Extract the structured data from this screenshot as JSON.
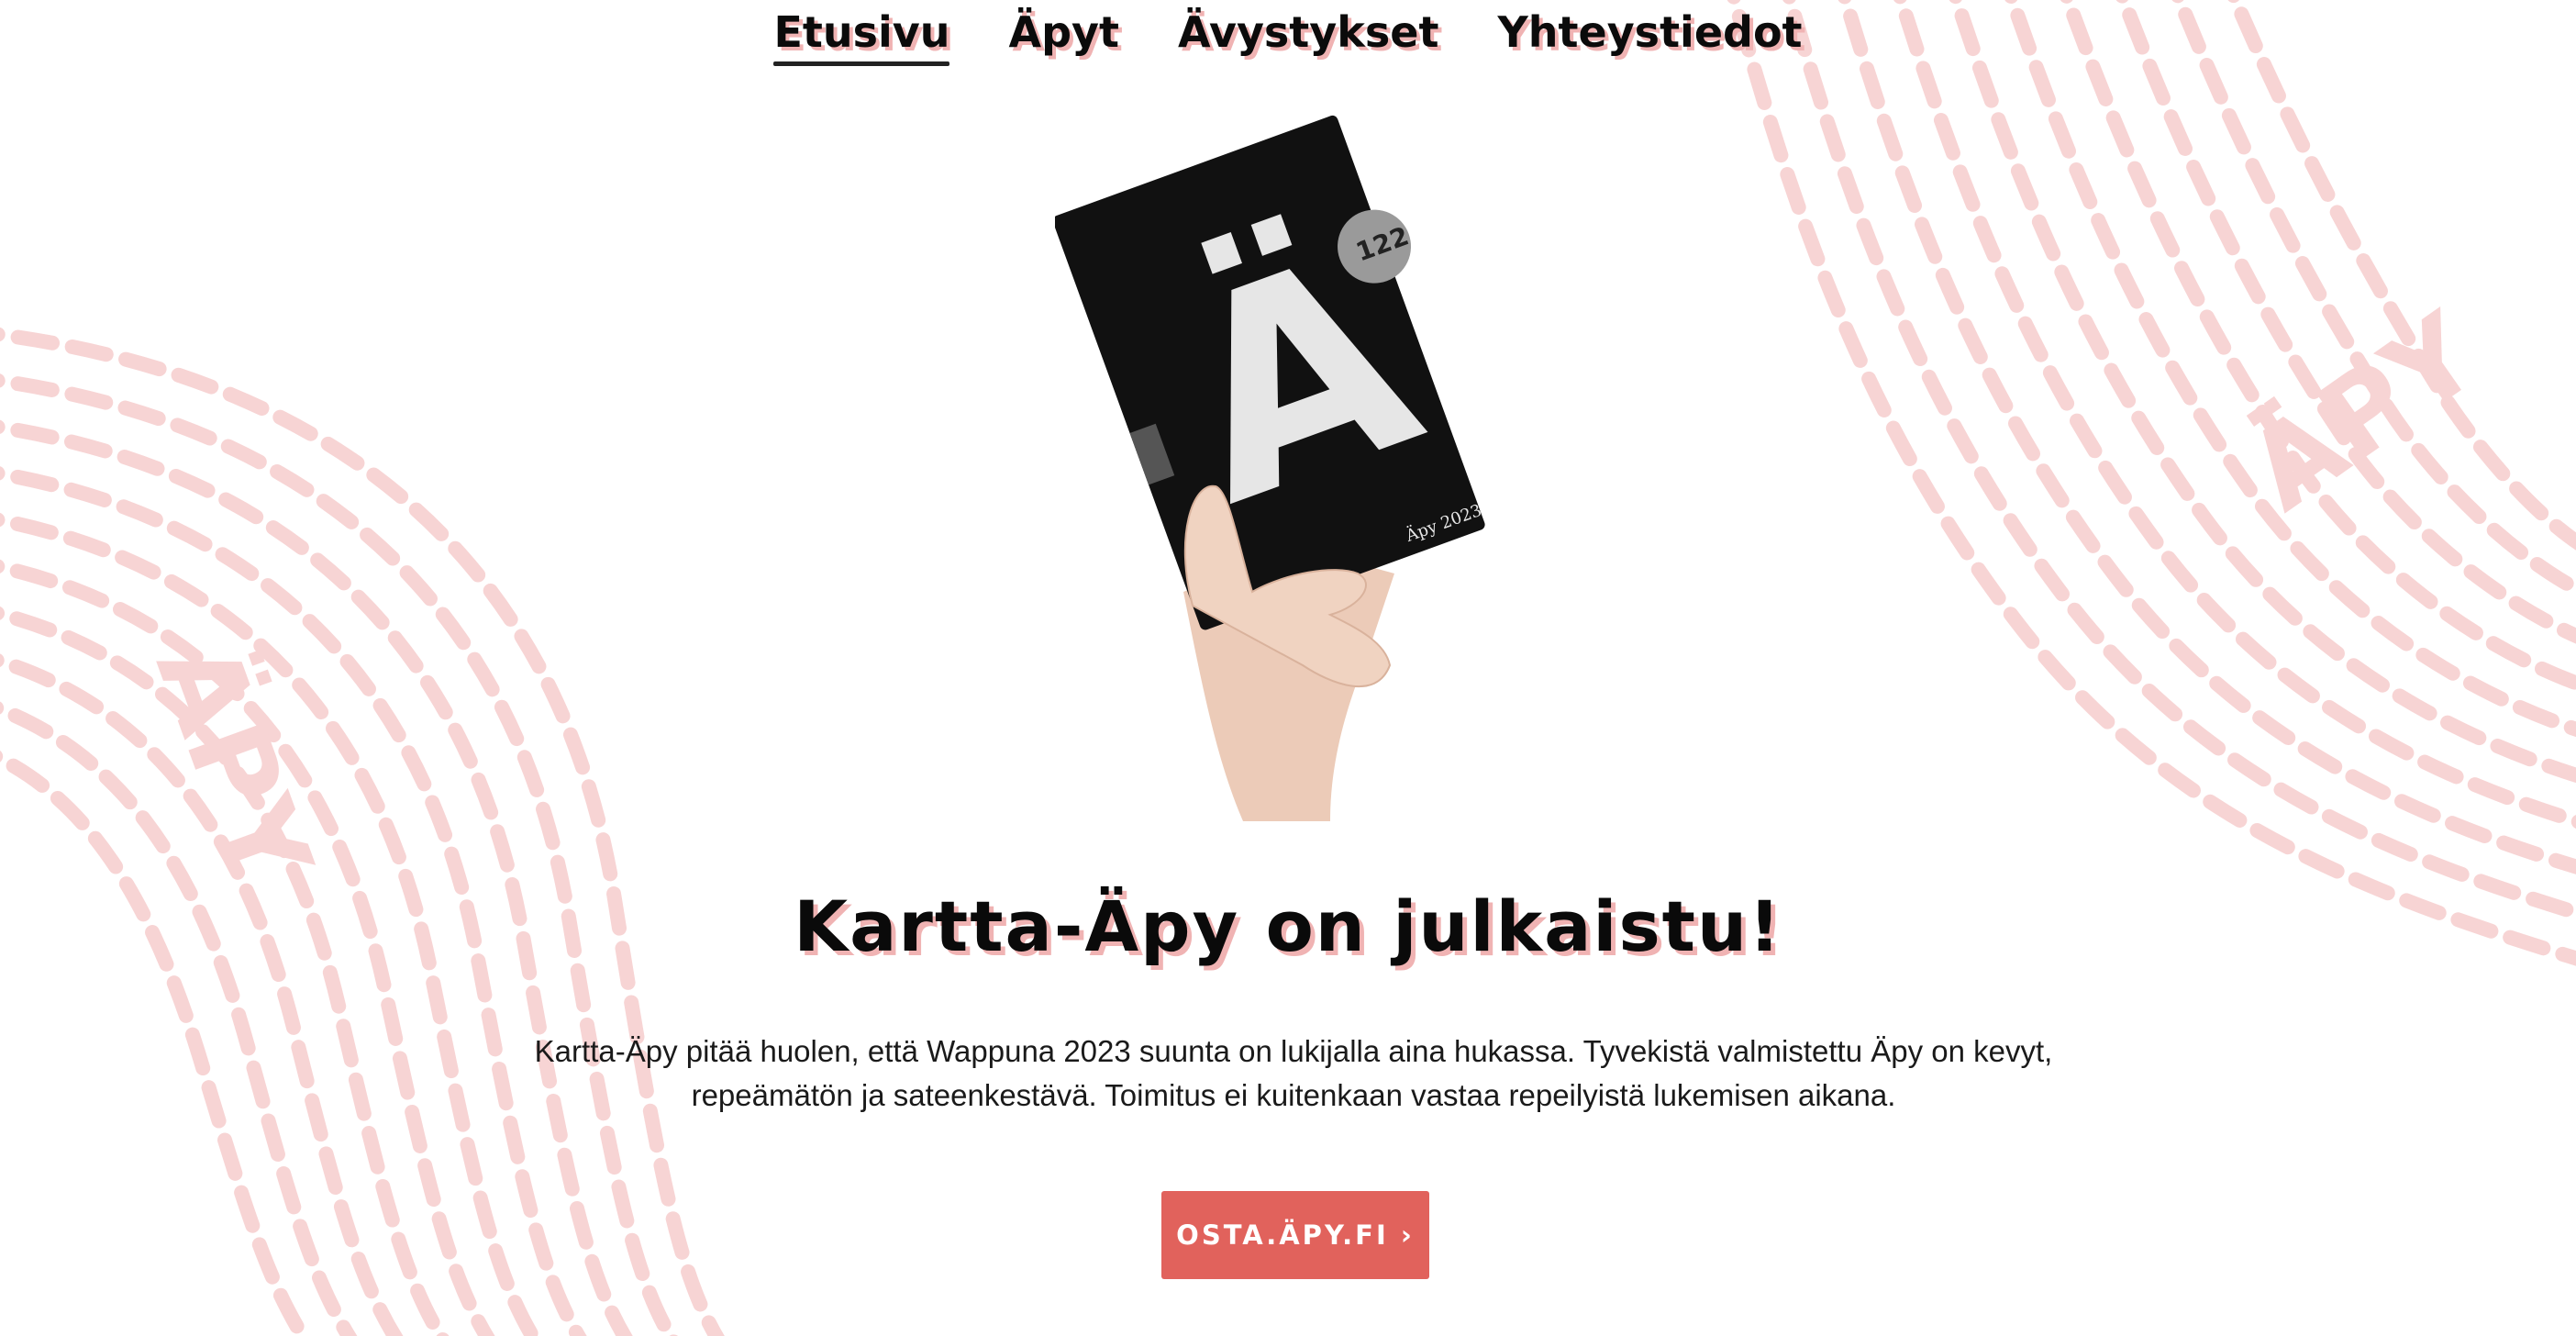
{
  "nav": {
    "items": [
      {
        "label": "Etusivu",
        "active": true
      },
      {
        "label": "Äpyt",
        "active": false
      },
      {
        "label": "Ävystykset",
        "active": false
      },
      {
        "label": "Yhteystiedot",
        "active": false
      }
    ]
  },
  "hero": {
    "cover_letter": "Ä",
    "cover_caption": "Äpy 2023",
    "cover_badge": "122"
  },
  "main": {
    "headline": "Kartta-Äpy on julkaistu!",
    "body": "Kartta-Äpy pitää huolen, että Wappuna 2023 suunta on lukijalla aina hukassa. Tyvekistä valmistettu Äpy on kevyt, repeämätön ja sateenkestävä. Toimitus ei kuitenkaan vastaa repeilyistä lukemisen aikana.",
    "cta_label": "OSTA.ÄPY.FI ›"
  },
  "background": {
    "pattern_text": "ÄPY"
  },
  "colors": {
    "accent": "#e1625c",
    "pattern": "#f6d3d3",
    "shadow": "#f0b3b3",
    "text": "#0a0a0a"
  }
}
